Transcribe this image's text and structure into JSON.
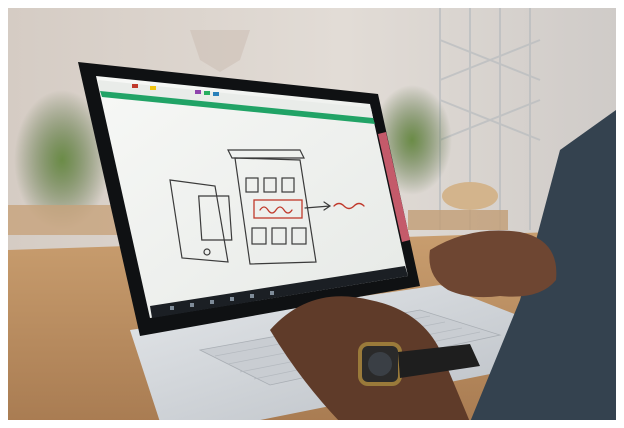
{
  "photo": {
    "subject": "person-drawing-wireframe-on-laptop",
    "colors": {
      "wall": "#dcd6d0",
      "table": "#c49a6c",
      "laptop_body": "#d9dde1",
      "bezel": "#141618",
      "screen": "#f4f6f3",
      "app_green": "#21a366",
      "ink_dark": "#3b3b3b",
      "ink_red": "#c0392b",
      "skin": "#6e4632",
      "sleeve": "#3a4a5a",
      "watch_gold": "#9a7a3a",
      "plant": "#5c7d3e"
    }
  }
}
